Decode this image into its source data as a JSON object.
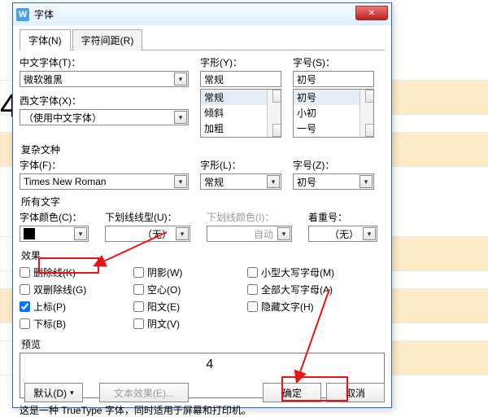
{
  "title": "字体",
  "close_glyph": "✕",
  "tabs": {
    "font": "字体(N)",
    "spacing": "字符间距(R)"
  },
  "cn_font": {
    "label": "中文字体(T)：",
    "value": "微软雅黑"
  },
  "style": {
    "label": "字形(Y)：",
    "value": "常规",
    "items": [
      "常规",
      "倾斜",
      "加粗"
    ]
  },
  "size": {
    "label": "字号(S)：",
    "value": "初号",
    "items": [
      "初号",
      "小初",
      "一号"
    ]
  },
  "western": {
    "label": "西文字体(X)：",
    "value": "（使用中文字体）"
  },
  "complex": {
    "legend": "复杂文种",
    "font_label": "字体(F)：",
    "font_value": "Times New Roman",
    "style_label": "字形(L)：",
    "style_value": "常规",
    "size_label": "字号(Z)：",
    "size_value": "初号"
  },
  "all": {
    "legend": "所有文字",
    "color_label": "字体颜色(C)：",
    "underline_label": "下划线线型(U)：",
    "underline_value": "（无）",
    "underline_color_label": "下划线颜色(I)：",
    "underline_color_value": "自动",
    "emphasis_label": "着重号：",
    "emphasis_value": "（无）"
  },
  "effects": {
    "legend": "效果",
    "strike": "删除线(K)",
    "dblstrike": "双删除线(G)",
    "superscript": "上标(P)",
    "subscript": "下标(B)",
    "shadow": "阴影(W)",
    "hollow": "空心(O)",
    "emboss": "阳文(E)",
    "engrave": "阴文(V)",
    "smallcaps": "小型大写字母(M)",
    "allcaps": "全部大写字母(A)",
    "hidden": "隐藏文字(H)"
  },
  "preview": {
    "label": "预览",
    "sample": "4"
  },
  "note": "这是一种 TrueType 字体，同时适用于屏幕和打印机。",
  "buttons": {
    "default": "默认(D)",
    "text_effects": "文本效果(E)...",
    "ok": "确定",
    "cancel": "取消"
  },
  "bg_sample": "4",
  "dropdown_glyph": "▾",
  "up_glyph": "▴"
}
